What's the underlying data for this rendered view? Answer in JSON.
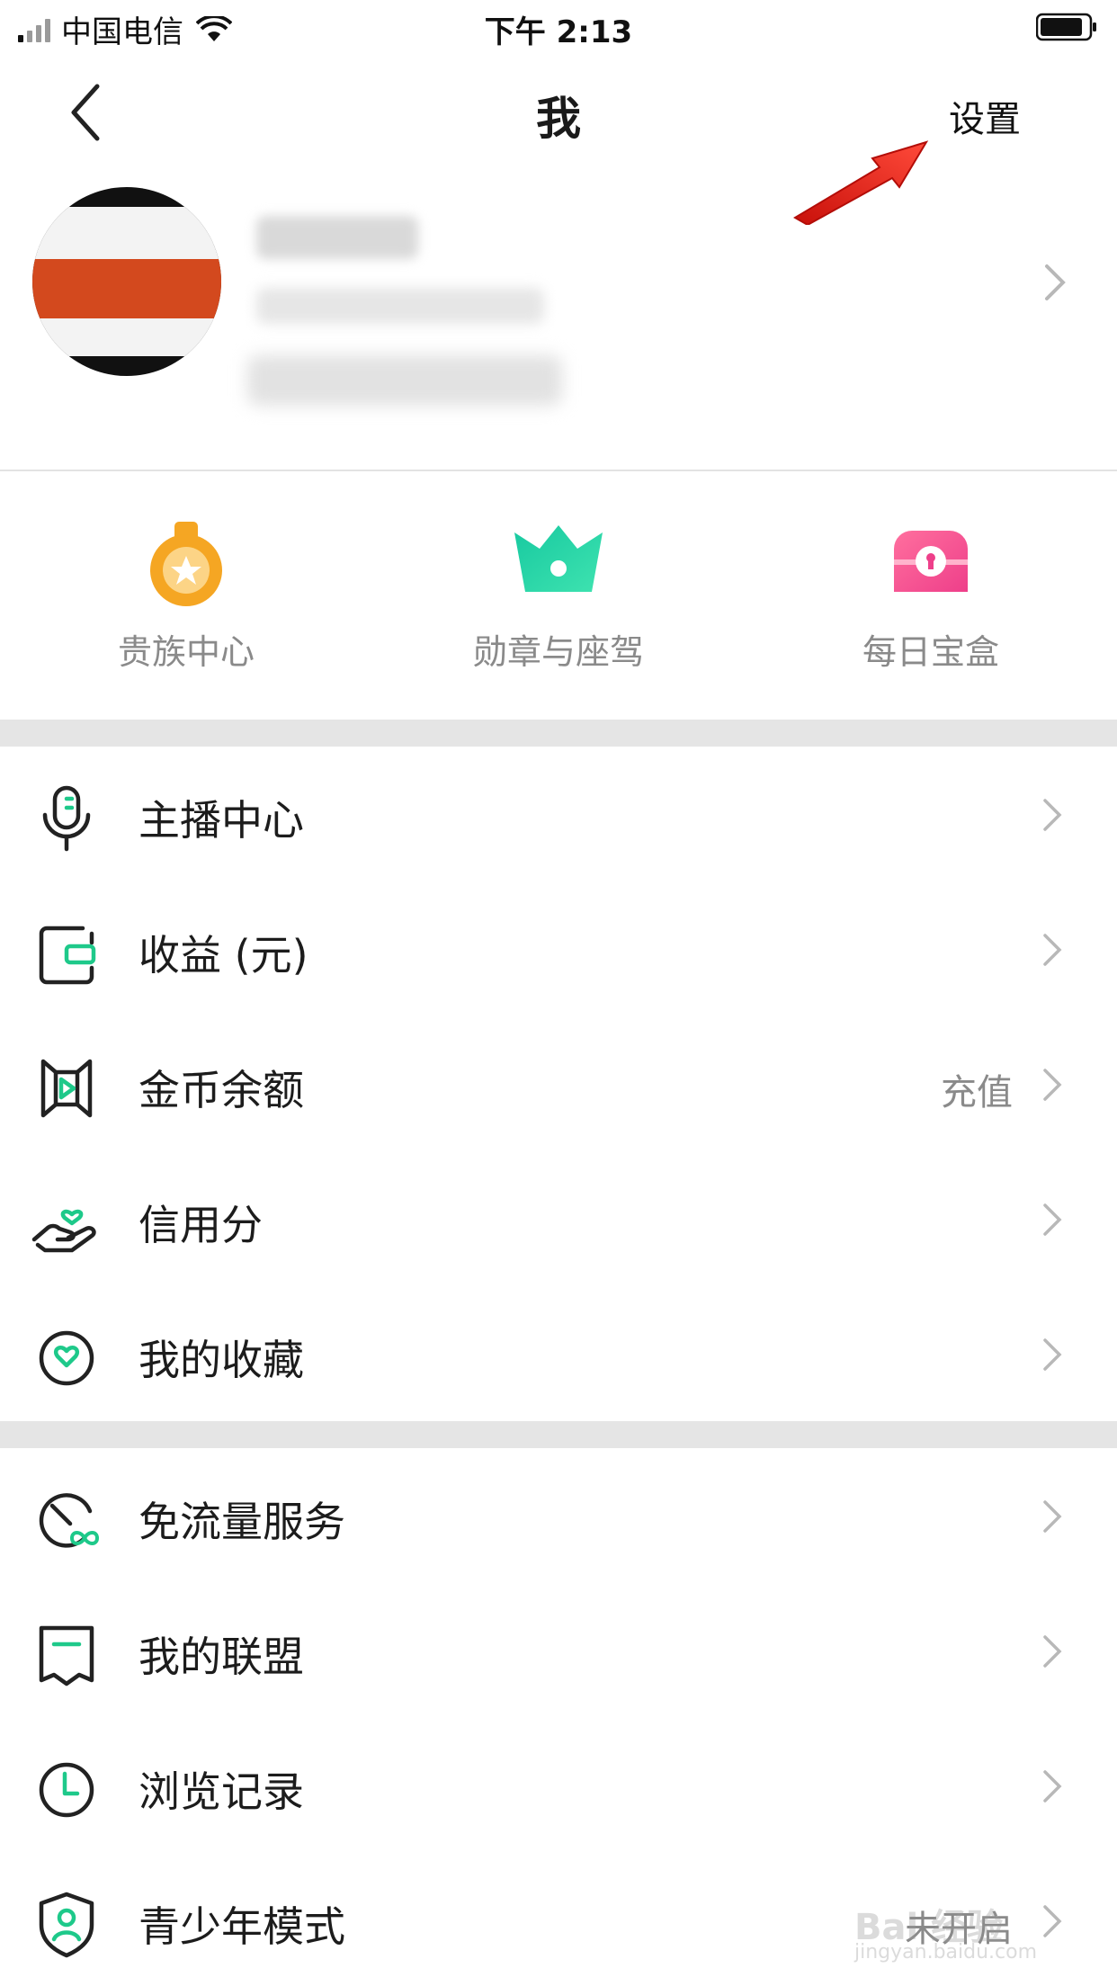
{
  "status_bar": {
    "carrier": "中国电信",
    "time": "下午 2:13"
  },
  "nav": {
    "title": "我",
    "settings_label": "设置"
  },
  "quick_tiles": [
    {
      "label": "贵族中心",
      "icon": "medal-icon"
    },
    {
      "label": "勋章与座驾",
      "icon": "crown-icon"
    },
    {
      "label": "每日宝盒",
      "icon": "treasure-box-icon"
    }
  ],
  "menu_group_1": [
    {
      "label": "主播中心",
      "icon": "microphone-icon",
      "value": ""
    },
    {
      "label": "收益 (元)",
      "icon": "wallet-icon",
      "value": ""
    },
    {
      "label": "金币余额",
      "icon": "coin-balance-icon",
      "value": "充值"
    },
    {
      "label": "信用分",
      "icon": "heart-hand-icon",
      "value": ""
    },
    {
      "label": "我的收藏",
      "icon": "heart-circle-icon",
      "value": ""
    }
  ],
  "menu_group_2": [
    {
      "label": "免流量服务",
      "icon": "data-free-icon",
      "value": ""
    },
    {
      "label": "我的联盟",
      "icon": "alliance-icon",
      "value": ""
    },
    {
      "label": "浏览记录",
      "icon": "clock-icon",
      "value": ""
    },
    {
      "label": "青少年模式",
      "icon": "shield-user-icon",
      "value": "未开启"
    }
  ],
  "watermark": {
    "text": "Bai 经验",
    "sub": "jingyan.baidu.com"
  },
  "colors": {
    "accent_green": "#1ec98a",
    "orange": "#f5a623",
    "pink": "#f0508c",
    "annotation_red": "#e8231c"
  }
}
